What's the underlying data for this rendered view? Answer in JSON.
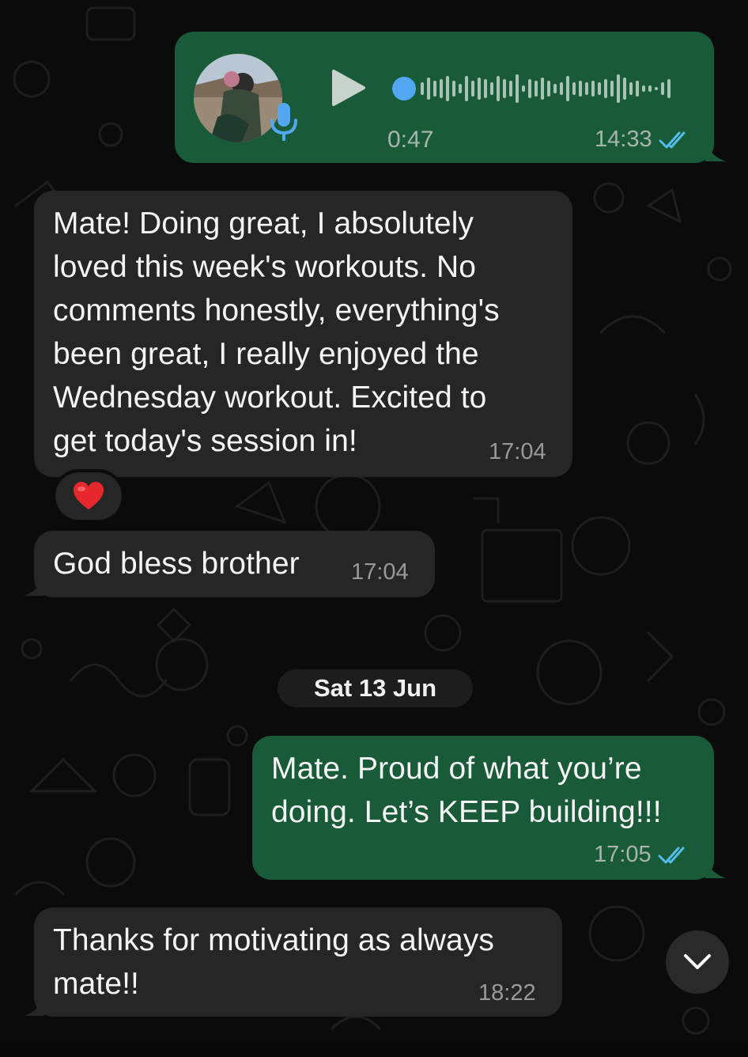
{
  "theme": {
    "outgoing_bubble": "#195a39",
    "incoming_bubble": "#262626",
    "background": "#0b0b0b",
    "read_tick_color": "#53bdeb",
    "voice_dot_color": "#53a6f0"
  },
  "messages": [
    {
      "direction": "outgoing",
      "type": "voice",
      "duration": "0:47",
      "time": "14:33",
      "status": "read"
    },
    {
      "direction": "incoming",
      "type": "text",
      "text": "Mate! Doing great, I absolutely\nloved this week's workouts. No\ncomments honestly, everything's\nbeen great, I really enjoyed the\nWednesday workout. Excited to\nget today's session in!",
      "time": "17:04",
      "reaction": "❤️"
    },
    {
      "direction": "incoming",
      "type": "text",
      "text": "God bless brother",
      "time": "17:04"
    },
    {
      "direction": "outgoing",
      "type": "text",
      "text": "Mate. Proud of what you’re\ndoing. Let’s KEEP building!!!",
      "time": "17:05",
      "status": "read"
    },
    {
      "direction": "incoming",
      "type": "text",
      "text": "Thanks for motivating as always\nmate!!",
      "time": "18:22"
    }
  ],
  "date_separator": "Sat 13 Jun",
  "icons": {
    "play": "play-icon",
    "mic": "mic-icon",
    "read_ticks": "double-check-icon",
    "scroll_down": "chevron-down-icon",
    "reaction": "heart-emoji"
  }
}
